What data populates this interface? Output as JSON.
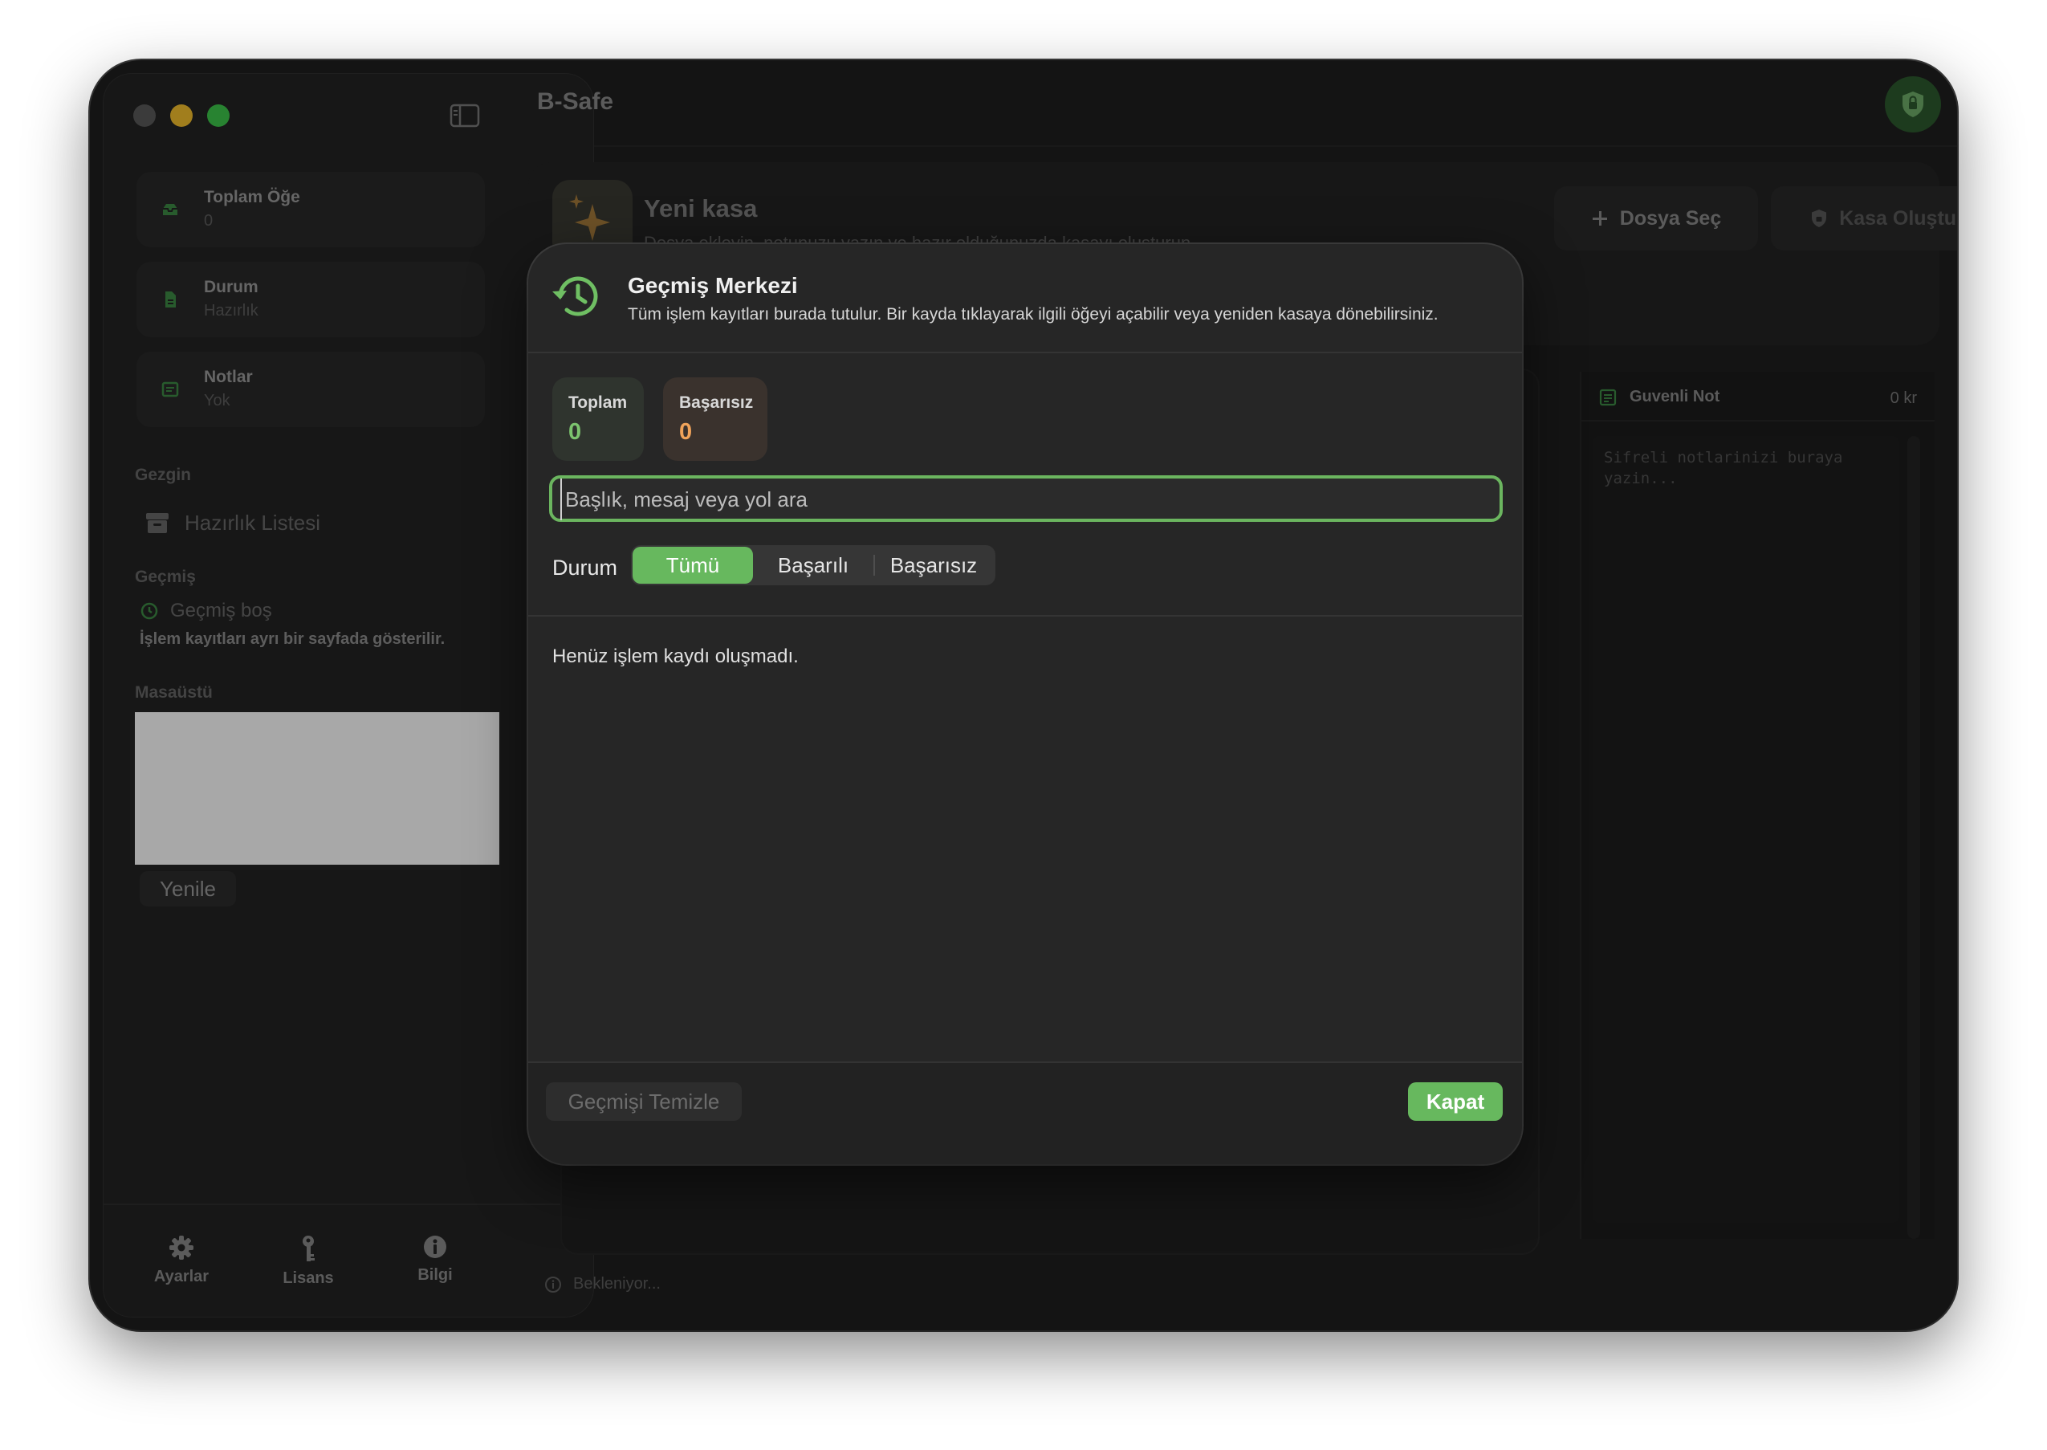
{
  "window": {
    "app_title": "B-Safe"
  },
  "sidebar": {
    "stats": [
      {
        "title": "Toplam Öğe",
        "value": "0"
      },
      {
        "title": "Durum",
        "value": "Hazırlık"
      },
      {
        "title": "Notlar",
        "value": "Yok"
      }
    ],
    "explorer": {
      "title": "Gezgin",
      "item": "Hazırlık Listesi"
    },
    "history": {
      "title": "Geçmiş",
      "empty": "Geçmiş boş",
      "note": "İşlem kayıtları ayrı bir sayfada gösterilir."
    },
    "desktop": {
      "title": "Masaüstü",
      "refresh_label": "Yenile"
    },
    "footer": [
      {
        "label": "Ayarlar",
        "icon": "gear-icon"
      },
      {
        "label": "Lisans",
        "icon": "key-icon"
      },
      {
        "label": "Bilgi",
        "icon": "info-icon"
      }
    ]
  },
  "main": {
    "card": {
      "title": "Yeni kasa",
      "subtitle": "Dosya ekleyin, notunuzu yazın ve hazır olduğunuzda kasayı oluşturun.",
      "file_button": "Dosya Seç",
      "create_button": "Kasa Oluştur"
    },
    "notes": {
      "title": "Guvenli Not",
      "count": "0 kr",
      "placeholder": "Sifreli notlarinizi buraya yazin..."
    },
    "status": "Bekleniyor..."
  },
  "dialog": {
    "title": "Geçmiş Merkezi",
    "subtitle": "Tüm işlem kayıtları burada tutulur. Bir kayda tıklayarak ilgili öğeyi açabilir veya yeniden kasaya dönebilirsiniz.",
    "counts": {
      "total_label": "Toplam",
      "total_value": "0",
      "failed_label": "Başarısız",
      "failed_value": "0"
    },
    "search_placeholder": "Başlık, mesaj veya yol ara",
    "filter": {
      "label": "Durum",
      "options": [
        "Tümü",
        "Başarılı",
        "Başarısız"
      ],
      "selected": "Tümü"
    },
    "empty_message": "Henüz işlem kaydı oluşmadı.",
    "clear_button": "Geçmişi Temizle",
    "close_button": "Kapat"
  },
  "colors": {
    "accent": "#67b85e",
    "total_value": "#7cc46e",
    "failed_value": "#f0a35a",
    "window_bg": "#1f1f1f"
  }
}
